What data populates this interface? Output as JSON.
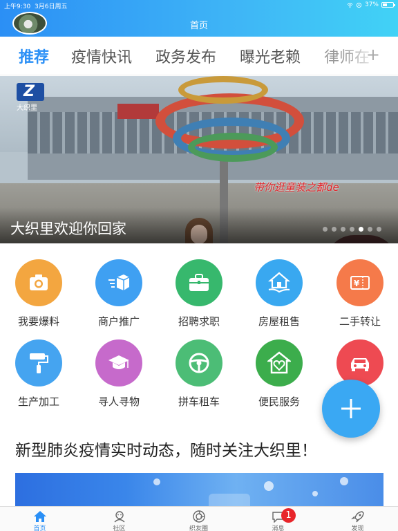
{
  "status_bar": {
    "time": "上午9:30",
    "date": "3月6日周五",
    "battery": "37%"
  },
  "header": {
    "title": "首页"
  },
  "tabs": [
    {
      "label": "推荐",
      "active": true
    },
    {
      "label": "疫情快讯"
    },
    {
      "label": "政务发布"
    },
    {
      "label": "曝光老赖"
    },
    {
      "label": "律师在"
    }
  ],
  "tabs_more_label": "+",
  "banner": {
    "logo_text": "大织里",
    "subtitle": "带你逛童装之都de",
    "caption": "大织里欢迎你回家",
    "slide_count": 7,
    "active_slide": 4
  },
  "services": [
    {
      "label": "我要爆料",
      "icon": "camera-icon",
      "color": "#f3a640"
    },
    {
      "label": "商户推广",
      "icon": "delivery-box-icon",
      "color": "#3fa0f2"
    },
    {
      "label": "招聘求职",
      "icon": "briefcase-icon",
      "color": "#37b86d"
    },
    {
      "label": "房屋租售",
      "icon": "house-hand-icon",
      "color": "#39a8f0"
    },
    {
      "label": "二手转让",
      "icon": "ticket-icon",
      "color": "#f57a4a"
    },
    {
      "label": "生产加工",
      "icon": "paint-roller-icon",
      "color": "#45a4f0"
    },
    {
      "label": "寻人寻物",
      "icon": "graduation-cap-icon",
      "color": "#c66acb"
    },
    {
      "label": "拼车租车",
      "icon": "steering-wheel-icon",
      "color": "#4cbd76"
    },
    {
      "label": "便民服务",
      "icon": "heart-house-icon",
      "color": "#3cad4c"
    },
    {
      "label": "",
      "icon": "car-icon",
      "color": "#ee4a52"
    }
  ],
  "fab": {
    "icon": "plus-icon"
  },
  "headline": "新型肺炎疫情实时动态，随时关注大织里！",
  "bottom_nav": [
    {
      "label": "首页",
      "icon": "home-icon",
      "active": true
    },
    {
      "label": "社区",
      "icon": "community-icon"
    },
    {
      "label": "织友圈",
      "icon": "camera-aperture-icon"
    },
    {
      "label": "消息",
      "icon": "message-icon",
      "badge": "1"
    },
    {
      "label": "发现",
      "icon": "rocket-icon"
    }
  ]
}
